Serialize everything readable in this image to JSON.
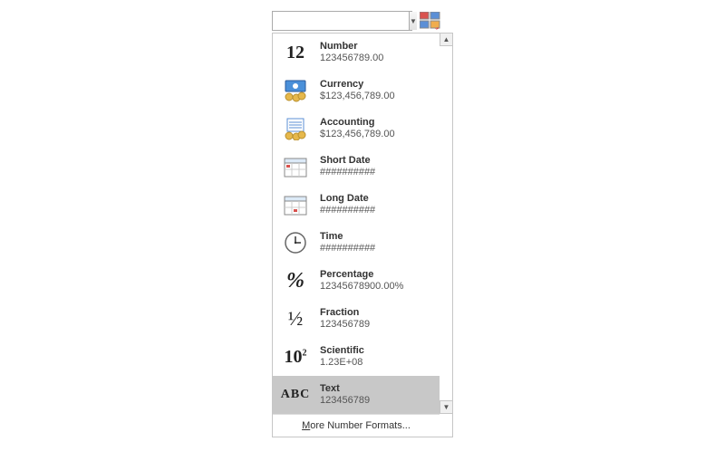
{
  "combo": {
    "value": ""
  },
  "items": [
    {
      "label": "Number",
      "sample": "123456789.00"
    },
    {
      "label": "Currency",
      "sample": "$123,456,789.00"
    },
    {
      "label": "Accounting",
      "sample": "$123,456,789.00"
    },
    {
      "label": "Short Date",
      "sample": "##########"
    },
    {
      "label": "Long Date",
      "sample": "##########"
    },
    {
      "label": "Time",
      "sample": "##########"
    },
    {
      "label": "Percentage",
      "sample": "12345678900.00%"
    },
    {
      "label": "Fraction",
      "sample": "123456789"
    },
    {
      "label": "Scientific",
      "sample": "1.23E+08"
    },
    {
      "label": "Text",
      "sample": "123456789"
    }
  ],
  "footer": {
    "prefix": "M",
    "rest": "ore Number Formats..."
  }
}
